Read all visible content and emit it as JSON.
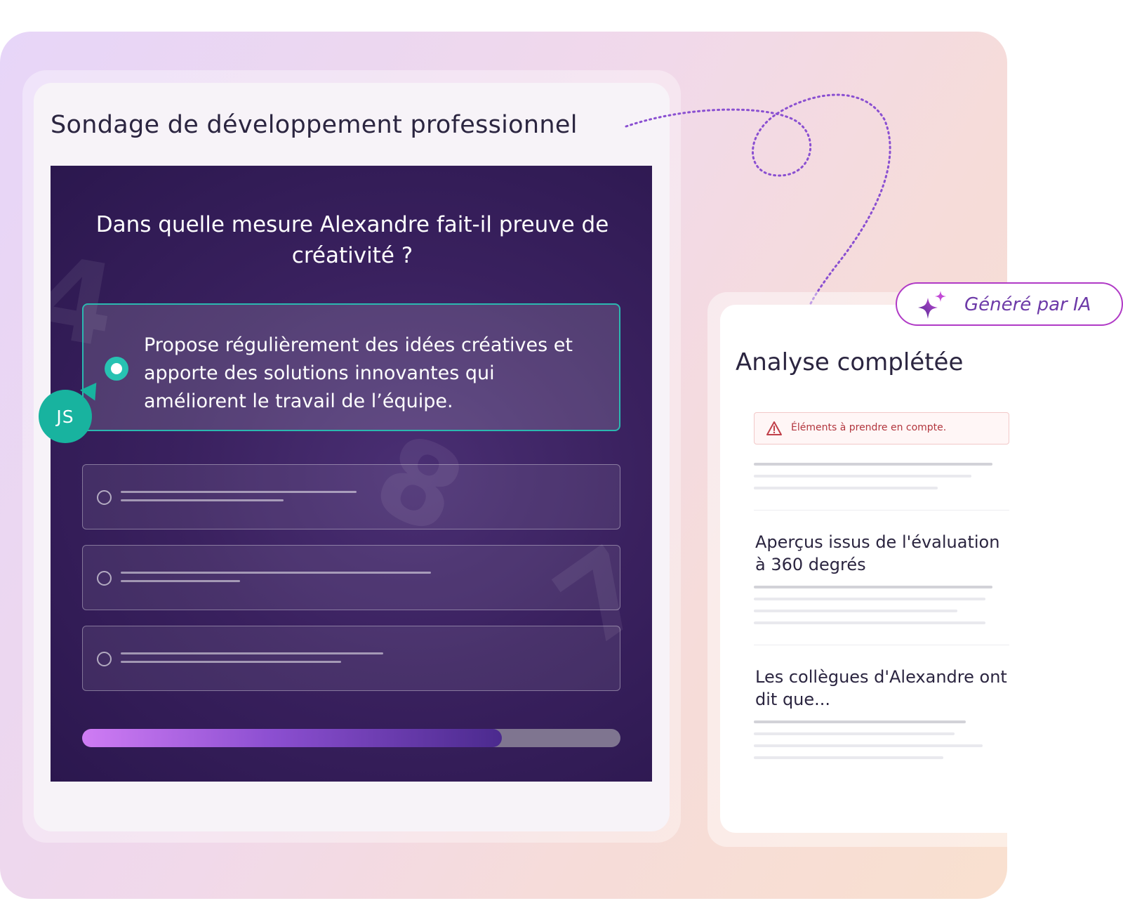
{
  "survey": {
    "title": "Sondage de développement professionnel",
    "question": "Dans quelle mesure Alexandre fait-il preuve de créativité ?",
    "selected_option": "Propose régulièrement des idées créatives et apporte des solutions innovantes qui améliorent le travail de l’équipe.",
    "other_options_count": 3,
    "progress": 0.78,
    "avatar_initials": "JS",
    "colors": {
      "accent": "#18b39f",
      "panel": "#3a215f",
      "progress": "#8c4fd1"
    }
  },
  "analysis": {
    "title": "Analyse complétée",
    "alert": "Éléments à prendre en compte.",
    "section1_title": "Aperçus issus de l'évaluation à 360 degrés",
    "section2_title": "Les collègues d'Alexandre ont dit que..."
  },
  "badge": {
    "label": "Généré par IA",
    "icon": "sparkle-icon",
    "color": "#b03ac6"
  }
}
